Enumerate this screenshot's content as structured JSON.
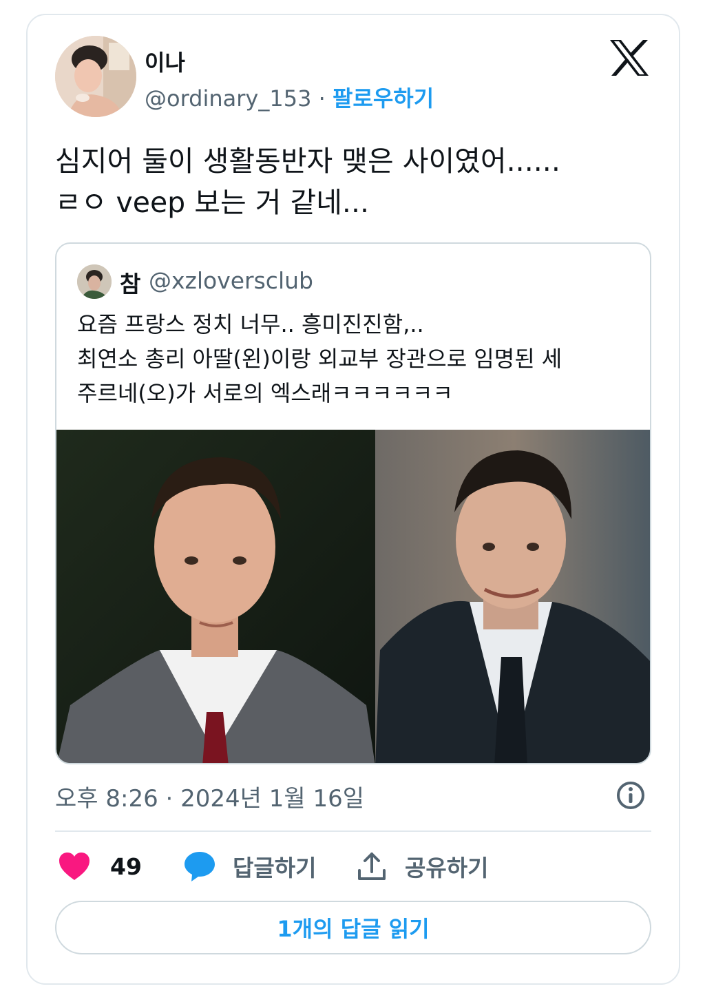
{
  "author": {
    "name": "이나",
    "handle": "@ordinary_153",
    "separator": "·",
    "follow_label": "팔로우하기"
  },
  "platform_icon": "x-logo-icon",
  "tweet": {
    "lines": [
      "심지어 둘이 생활동반자 맺은 사이였어......",
      "ㄹㅇ  veep 보는 거 같네..."
    ]
  },
  "quote": {
    "name": "참",
    "handle": "@xzloversclub",
    "lines": [
      "요즘 프랑스 정치 너무.. 흥미진진함,..",
      "최연소 총리 아딸(왼)이랑 외교부 장관으로 임명된 세",
      "주르네(오)가 서로의 엑스래ㅋㅋㅋㅋㅋㅋ"
    ]
  },
  "timestamp": "오후 8:26 · 2024년 1월 16일",
  "actions": {
    "like_count": "49",
    "reply_label": "답글하기",
    "share_label": "공유하기"
  },
  "read_replies_label": "1개의 답글 읽기",
  "colors": {
    "accent": "#1d9bf0",
    "like": "#f91880",
    "text": "#0f1419",
    "muted": "#536471",
    "border": "#cfd9de"
  }
}
